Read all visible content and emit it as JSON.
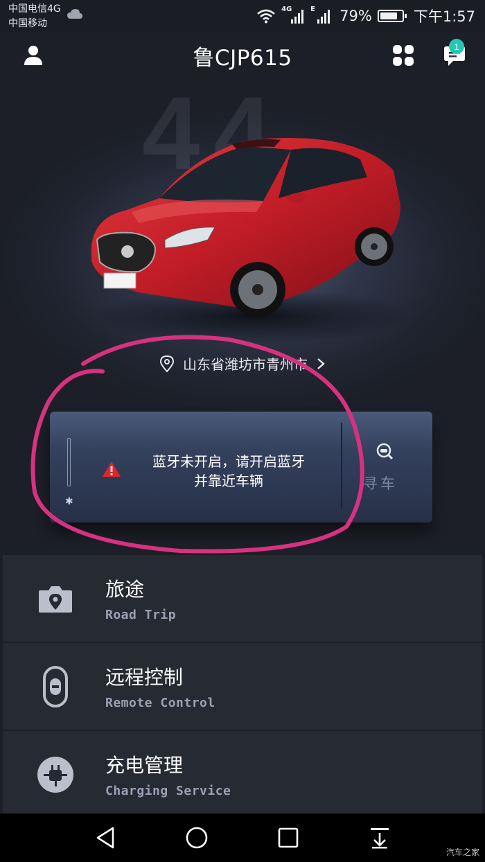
{
  "status_bar": {
    "carrier_1": "中国电信4G",
    "carrier_2": "中国移动",
    "net_4g": "4G",
    "net_e": "E",
    "battery_pct": "79%",
    "battery_level": 0.79,
    "time": "下午1:57"
  },
  "header": {
    "plate": "鲁CJP615",
    "notification_count": "1",
    "icons": [
      "user-icon",
      "grid-icon",
      "message-icon"
    ]
  },
  "hero": {
    "big_number": "44",
    "location": "山东省潍坊市青州市"
  },
  "bluetooth_card": {
    "message_line1": "蓝牙未开启，请开启蓝牙",
    "message_line2": "并靠近车辆",
    "bt_symbol": "✱",
    "find_car_label": "寻车"
  },
  "menu": [
    {
      "title": "旅途",
      "subtitle": "Road Trip",
      "icon": "camera-pin-icon"
    },
    {
      "title": "远程控制",
      "subtitle": "Remote Control",
      "icon": "key-fob-icon"
    },
    {
      "title": "充电管理",
      "subtitle": "Charging Service",
      "icon": "plug-icon"
    }
  ],
  "navbar": {
    "watermark": "汽车之家"
  },
  "colors": {
    "accent_badge": "#25c7b3",
    "annotation_circle": "#d6327f",
    "warning_red": "#e0252b",
    "car_red": "#c4202a"
  }
}
